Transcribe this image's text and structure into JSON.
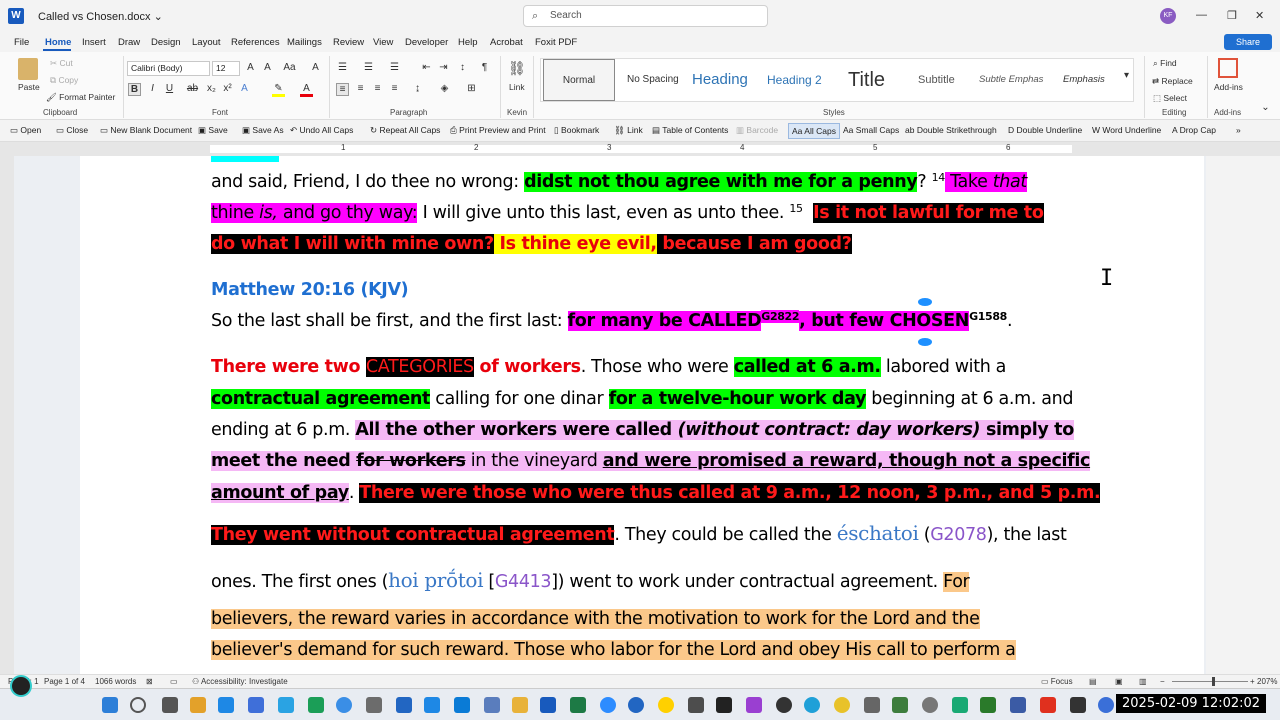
{
  "titlebar": {
    "document_name": "Called vs Chosen.docx",
    "chevron": "⌄",
    "search_placeholder": "Search",
    "avatar_initials": "KF"
  },
  "menu_tabs": [
    "File",
    "Home",
    "Insert",
    "Draw",
    "Design",
    "Layout",
    "References",
    "Mailings",
    "Review",
    "View",
    "Developer",
    "Help",
    "Acrobat",
    "Foxit PDF"
  ],
  "share_label": "Share",
  "ribbon": {
    "clipboard": {
      "paste": "Paste",
      "cut": "Cut",
      "copy": "Copy",
      "format_painter": "Format Painter",
      "label": "Clipboard"
    },
    "font": {
      "name": "Calibri (Body)",
      "size": "12",
      "label": "Font"
    },
    "paragraph": {
      "label": "Paragraph"
    },
    "kevin": {
      "link": "Link",
      "label": "Kevin"
    },
    "styles": {
      "items": [
        "Normal",
        "No Spacing",
        "Heading",
        "Heading 2",
        "Title",
        "Subtitle",
        "Subtle Emphas",
        "Emphasis"
      ],
      "label": "Styles"
    },
    "editing": {
      "find": "Find",
      "replace": "Replace",
      "select": "Select",
      "label": "Editing"
    },
    "addins": {
      "button": "Add-ins",
      "label": "Add-ins"
    }
  },
  "quick_access": [
    "Open",
    "Close",
    "New Blank Document",
    "Save",
    "Save As",
    "Undo All Caps",
    "Repeat All Caps",
    "Print Preview and Print",
    "Bookmark",
    "Link",
    "Table of Contents",
    "Barcode",
    "All Caps",
    "Small Caps",
    "Double Strikethrough",
    "Double Underline",
    "Word Underline",
    "Drop Cap"
  ],
  "ruler_ticks": [
    "1",
    "2",
    "3",
    "4",
    "5",
    "6"
  ],
  "doc": {
    "l1_a": "and said, Friend, I do thee no wrong: ",
    "l1_b": "didst not thou agree with me for a penny",
    "l1_c": "? ",
    "l1_sup14": "14",
    "l1_d": " Take ",
    "l1_e": "that",
    "l2_a": "thine ",
    "l2_b": "is,",
    "l2_c": " and go thy way:",
    "l2_d": " I will give unto this last, even as unto thee. ",
    "l2_sup15": "15",
    "l2_e": "Is it not lawful for me to",
    "l3_a": "do what I will with mine own?",
    "l3_b": " Is thine eye evil,",
    "l3_c": " because I am good?",
    "heading": "Matthew 20:16 (KJV)",
    "l4_a": " So the last shall be first, and the first last: ",
    "l4_b": "for many be CALLED",
    "l4_sup_a": "G2822",
    "l4_c": ", but few CHOSEN",
    "l4_sup_b": "G1588",
    "l4_d": ".",
    "p1_a": "There were two ",
    "p1_b": "CATEGORIES",
    "p1_c": " of workers",
    "p1_d": ". Those who were ",
    "p1_e": "called at 6 a.m.",
    "p1_f": " labored with a",
    "p2_a": "contractual agreement",
    "p2_b": " calling for one dinar ",
    "p2_c": "for a twelve-hour work day",
    "p2_d": " beginning at 6 a.m. and",
    "p3_a": "ending at 6 p.m. ",
    "p3_b": "All the other workers were called ",
    "p3_c": "(without contract: day workers)",
    "p3_d": " simply to",
    "p4_a": "meet the need ",
    "p4_b": "for workers",
    "p4_c": " in the vineyard ",
    "p4_d": "and were promised a reward, though not a specific",
    "p5_a": "amount of pay",
    "p5_b": ". ",
    "p5_c": "There were those who were thus called at 9 a.m., 12 noon, 3 p.m., and 5 p.m.",
    "p6_a": "They went without contractual agreement",
    "p6_b": ". They could be called the ",
    "p6_c": "éschatoi",
    "p6_d": " (",
    "p6_e": "G2078",
    "p6_f": "), the last",
    "p7_a": "ones. The first ones (",
    "p7_b": "hoi prṓtoi",
    "p7_c": " [",
    "p7_d": "G4413",
    "p7_e": "]) went to work under contractual agreement. ",
    "p7_f": "For",
    "p8": "believers, the reward varies in accordance with the motivation to work for the Lord and the",
    "p9": "believer's demand for such reward. Those who labor for the Lord and obey His call to perform a"
  },
  "status": {
    "page": "PAGE: 1",
    "page_of": "Page 1 of 4",
    "words": "1066 words",
    "accessibility": "Accessibility: Investigate",
    "focus": "Focus",
    "zoom": "207%"
  },
  "taskbar": {
    "clock": "2025-02-09 12:02:02"
  }
}
